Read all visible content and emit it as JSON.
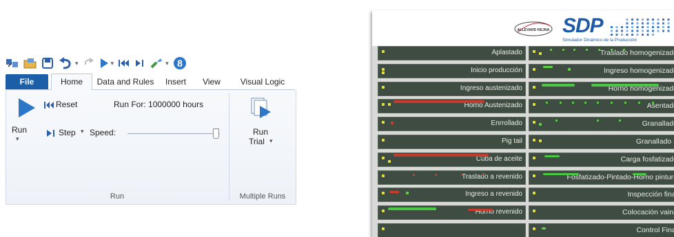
{
  "ribbon": {
    "qat_icons": [
      "model-icon",
      "open-icon",
      "save-icon",
      "undo-icon",
      "redo-icon",
      "play-icon",
      "rewind-icon",
      "step-icon",
      "build-icon",
      "help-icon"
    ],
    "tabs": [
      {
        "label": "File",
        "active": false
      },
      {
        "label": "Home",
        "active": true
      },
      {
        "label": "Data and Rules",
        "active": false
      },
      {
        "label": "Insert",
        "active": false
      },
      {
        "label": "View",
        "active": false
      },
      {
        "label": "Visual Logic",
        "active": false
      }
    ],
    "run_group": {
      "run_label": "Run",
      "reset_label": "Reset",
      "step_label": "Step",
      "speed_label": "Speed:",
      "run_for_text": "Run For: 1000000 hours",
      "group_label": "Run"
    },
    "multi_group": {
      "run_trial_line1": "Run",
      "run_trial_line2": "Trial",
      "group_label": "Multiple Runs"
    },
    "speed_level": 0.95
  },
  "sdp": {
    "brand_small": "ALLEVARD REJNA",
    "logo_text": "SDP",
    "subtitle": "Simulador Dinámico de la Producción",
    "left_rows": [
      "Aplastado",
      "Inicio producción",
      "Ingreso austenizado",
      "Horno Austenizado",
      "Enrrollado",
      "Pig tail",
      "Cuba de aceite",
      "Traslado a revenido",
      "Ingreso a revenido",
      "Horno revenido",
      ""
    ],
    "right_rows": [
      "Traslado homogenizado",
      "Ingreso homogenizado",
      "Horno homogenizado",
      "Asentado",
      "Granallado",
      "Granallado 2",
      "Carga fosfatizado",
      "Fosfatizado-Pintado-Horno pintura",
      "Inspección final",
      "Colocación vaina",
      "Control Final"
    ],
    "colors": {
      "panel": "#d9d9d7",
      "row": "#3f4c41",
      "green": "#4ac844",
      "red": "#c83a2e",
      "yellow": "#e3e33b",
      "blue": "#1e5aa8"
    }
  }
}
